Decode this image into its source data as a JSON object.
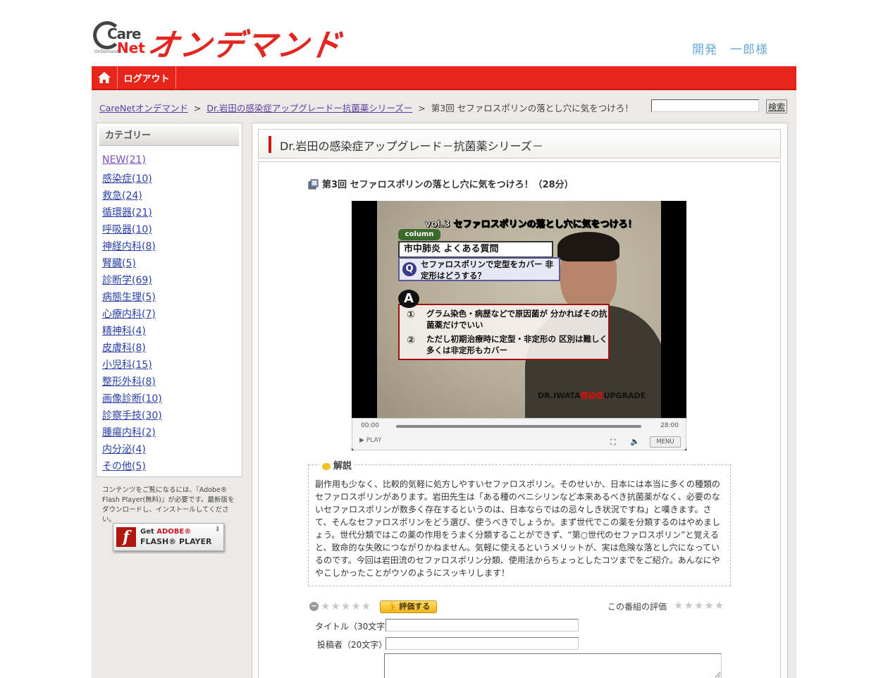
{
  "header": {
    "logo_care": "Care",
    "logo_net": "Net",
    "logo_ondemand_small": "OnDemand",
    "logo_title": "オンデマンド",
    "username": "開発　一郎様"
  },
  "nav": {
    "home_icon": "home-icon",
    "logout_label": "ログアウト"
  },
  "breadcrumb": {
    "items": [
      "CareNetオンデマンド",
      "Dr.岩田の感染症アップグレードー抗菌薬シリーズー",
      "第3回 セファロスポリンの落とし穴に気をつけろ！"
    ],
    "separator": ">"
  },
  "search": {
    "value": "",
    "button_label": "検索"
  },
  "sidebar": {
    "heading": "カテゴリー",
    "categories": [
      "NEW(21)",
      "感染症(10)",
      "救急(24)",
      "循環器(21)",
      "呼吸器(10)",
      "神経内科(8)",
      "腎臓(5)",
      "診断学(69)",
      "病態生理(5)",
      "心療内科(7)",
      "精神科(4)",
      "皮膚科(8)",
      "小児科(15)",
      "整形外科(8)",
      "画像診断(10)",
      "診察手技(30)",
      "腫瘍内科(2)",
      "内分泌(4)",
      "その他(5)"
    ],
    "flash_note": "コンテンツをご覧になるには、『Adobe® Flash Player(無料)』が必要です。最新版をダウンロードし、インストールしてください。",
    "flash_badge": {
      "line1_get": "Get",
      "line1_adobe": "ADOBE®",
      "line2": "FLASH® PLAYER"
    }
  },
  "main": {
    "series_title": "Dr.岩田の感染症アップグレード－抗菌薬シリーズ－",
    "episode_title": "第3回 セファロスポリンの落とし穴に気をつけろ！（28分）",
    "video": {
      "headline": "vol.3 セファロスポリンの落とし穴に気をつけろ！",
      "column_tag": "column",
      "subtitle": "市中肺炎 よくある質問",
      "q_mark": "Q",
      "question": "セファロスポリンで定型をカバー 非定形はどうする？",
      "a_mark": "A",
      "answer1_num": "①",
      "answer1": "グラム染色・病歴などで原因菌が 分かればその抗菌薬だけでいい",
      "answer2_num": "②",
      "answer2": "ただし初期治療時に定型・非定形の 区別は難しく多くは非定形もカバー",
      "footer_prefix": "DR.IWATA",
      "footer_red": "感染症",
      "footer_suffix": "UPGRADE"
    },
    "player": {
      "time_current": "00:00",
      "time_total": "28:00",
      "progress": 0,
      "play_label": "▶ PLAY",
      "fullscreen_icon": "fullscreen-icon",
      "volume_icon": "volume-icon",
      "menu_label": "MENU"
    },
    "description": {
      "heading": "解説",
      "text": "副作用も少なく、比較的気軽に処方しやすいセファロスポリン。そのせいか、日本には本当に多くの種類のセファロスポリンがあります。岩田先生は「ある種のペニシリンなど本来あるべき抗菌薬がなく、必要のないセファロスポリンが数多く存在するというのは、日本ならではの忌々しき状況ですね」と嘆きます。さて、そんなセファロスポリンをどう選び、使うべきでしょうか。まず世代でこの薬を分類するのはやめましょう。世代分類ではこの薬の作用をうまく分類することができず、“第○世代のセファロスポリン”と覚えると、致命的な失敗につながりかねません。気軽に使えるというメリットが、実は危険な落とし穴になっているのです。今回は岩田流のセファロスポリン分類、使用法からちょっとしたコツまでをご紹介。あんなにややこしかったことがウソのようにスッキリします！"
    },
    "rating": {
      "minus_label": "−",
      "input_stars": "★★★★★",
      "rate_button": "評価する",
      "program_rating_label": "この番組の評価",
      "program_stars": "★★★★★",
      "value": 0,
      "max": 5
    },
    "form": {
      "title_label": "タイトル（30文字）",
      "title_value": "",
      "author_label": "投稿者（20文字）",
      "author_value": "",
      "body_value": ""
    }
  },
  "colors": {
    "brand_red": "#e3261f",
    "nav_red": "#e8251a",
    "username_blue": "#6aaadb",
    "link_blue": "#2a3fa8",
    "link_visited": "#7a4ac0",
    "background_gray": "#eceae8"
  }
}
